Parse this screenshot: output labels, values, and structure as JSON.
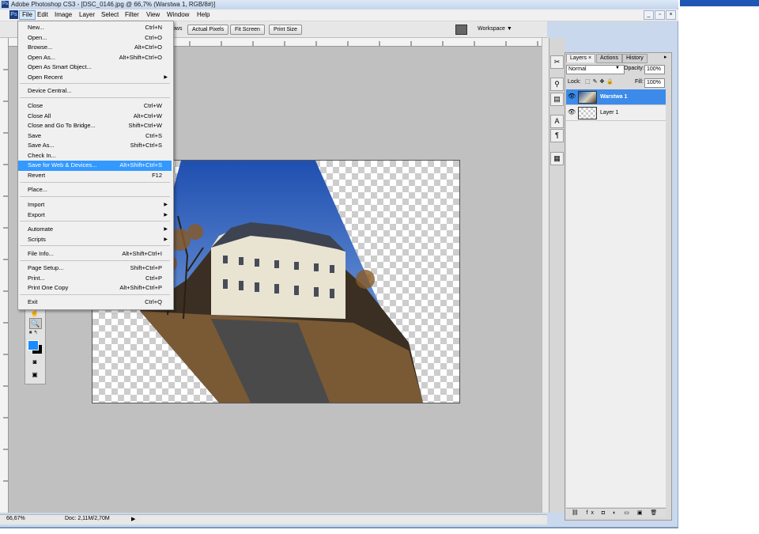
{
  "window": {
    "title": "Adobe Photoshop CS3 - [DSC_0146.jpg @ 66,7% (Warstwa 1, RGB/8#)]",
    "app_icon_text": "Ps"
  },
  "menubar": {
    "items": [
      "File",
      "Edit",
      "Image",
      "Layer",
      "Select",
      "Filter",
      "View",
      "Window",
      "Help"
    ],
    "doc_buttons": [
      "_",
      "▫",
      "×"
    ]
  },
  "options_bar": {
    "partial_label": "ows",
    "buttons": [
      "Actual Pixels",
      "Fit Screen",
      "Print Size"
    ],
    "workspace_label": "Workspace ▼"
  },
  "file_menu": {
    "items": [
      {
        "label": "New...",
        "shortcut": "Ctrl+N"
      },
      {
        "label": "Open...",
        "shortcut": "Ctrl+O"
      },
      {
        "label": "Browse...",
        "shortcut": "Alt+Ctrl+O"
      },
      {
        "label": "Open As...",
        "shortcut": "Alt+Shift+Ctrl+O"
      },
      {
        "label": "Open As Smart Object...",
        "shortcut": ""
      },
      {
        "label": "Open Recent",
        "shortcut": "",
        "submenu": true
      },
      {
        "label": "Device Central...",
        "shortcut": ""
      },
      {
        "label": "Close",
        "shortcut": "Ctrl+W"
      },
      {
        "label": "Close All",
        "shortcut": "Alt+Ctrl+W"
      },
      {
        "label": "Close and Go To Bridge...",
        "shortcut": "Shift+Ctrl+W"
      },
      {
        "label": "Save",
        "shortcut": "Ctrl+S"
      },
      {
        "label": "Save As...",
        "shortcut": "Shift+Ctrl+S"
      },
      {
        "label": "Check In...",
        "shortcut": ""
      },
      {
        "label": "Save for Web & Devices...",
        "shortcut": "Alt+Shift+Ctrl+S",
        "highlighted": true
      },
      {
        "label": "Revert",
        "shortcut": "F12"
      },
      {
        "label": "Place...",
        "shortcut": ""
      },
      {
        "label": "Import",
        "shortcut": "",
        "submenu": true
      },
      {
        "label": "Export",
        "shortcut": "",
        "submenu": true
      },
      {
        "label": "Automate",
        "shortcut": "",
        "submenu": true
      },
      {
        "label": "Scripts",
        "shortcut": "",
        "submenu": true
      },
      {
        "label": "File Info...",
        "shortcut": "Alt+Shift+Ctrl+I"
      },
      {
        "label": "Page Setup...",
        "shortcut": "Shift+Ctrl+P"
      },
      {
        "label": "Print...",
        "shortcut": "Ctrl+P"
      },
      {
        "label": "Print One Copy",
        "shortcut": "Alt+Shift+Ctrl+P"
      },
      {
        "label": "Exit",
        "shortcut": "Ctrl+Q"
      }
    ]
  },
  "layers_panel": {
    "tabs": [
      "Layers ×",
      "Actions",
      "History"
    ],
    "blend_mode": "Normal",
    "opacity_label": "Opacity:",
    "opacity": "100%",
    "lock_label": "Lock:",
    "fill_label": "Fill:",
    "fill": "100%",
    "layers": [
      {
        "name": "Warstwa 1",
        "selected": true
      },
      {
        "name": "Layer 1",
        "selected": false
      }
    ],
    "footer_icons": "⛓ fx ◘ ◐ ▭ ▣ 🗑"
  },
  "status_bar": {
    "zoom": "66,67%",
    "doc": "Doc: 2,11M/2,70M"
  },
  "colors": {
    "accent": "#3399ff",
    "layer_selected": "#3c8bea",
    "canvas_bg": "#c0c0c0"
  }
}
